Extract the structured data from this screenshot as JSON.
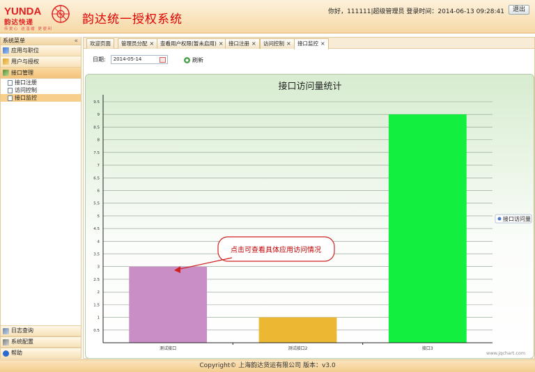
{
  "app": {
    "logo_text": "YUNDA",
    "logo_cn": "韵达快递",
    "logo_slogan": "传爱心 送温暖 更便利",
    "title": "韵达统一授权系统"
  },
  "header": {
    "user_info": "你好，111111|超级管理员  登录时间：2014-06-13 09:28:41",
    "logout_label": "退出"
  },
  "sidebar": {
    "title": "系统菜单",
    "collapse": "«",
    "groups": [
      {
        "label": "应用与职位"
      },
      {
        "label": "用户与授权"
      },
      {
        "label": "接口管理"
      }
    ],
    "sub_items": [
      {
        "label": "接口注册"
      },
      {
        "label": "访问控制"
      },
      {
        "label": "接口监控"
      }
    ],
    "bottom_groups": [
      {
        "label": "日志查询"
      },
      {
        "label": "系统配置"
      },
      {
        "label": "帮助"
      }
    ]
  },
  "tabs": [
    {
      "label": "欢迎页面",
      "close": ""
    },
    {
      "label": "管理员分配",
      "close": "×"
    },
    {
      "label": "查看用户权限(暂未启用)",
      "close": "×"
    },
    {
      "label": "接口注册",
      "close": "×"
    },
    {
      "label": "访问控制",
      "close": "×"
    },
    {
      "label": "接口监控",
      "close": "×"
    }
  ],
  "filter": {
    "date_label": "日期:",
    "date_value": "2014-05-14",
    "refresh_label": "刷新"
  },
  "callout": "点击可查看具体应用访问情况",
  "watermark": "www.jqchart.com",
  "footer": "Copyright© 上海韵达货运有限公司 版本：v3.0",
  "colors": {
    "accent": "#e00000",
    "header_bg": "#f6d9a6",
    "selected_item": "#f8cf8a"
  },
  "chart_data": {
    "type": "bar",
    "title": "接口访问量统计",
    "categories": [
      "测试接口",
      "测试接口2",
      "接口3"
    ],
    "series": [
      {
        "name": "接口访问量",
        "values": [
          3,
          1,
          9
        ],
        "colors": [
          "#c98ec6",
          "#ecb733",
          "#12ef3f"
        ]
      }
    ],
    "ylim": [
      0,
      9.5
    ],
    "yticks": [
      "0.5",
      "1",
      "1.5",
      "2",
      "2.5",
      "3",
      "3.5",
      "4",
      "4.5",
      "5",
      "5.5",
      "6",
      "6.5",
      "7",
      "7.5",
      "8",
      "8.5",
      "9",
      "9.5"
    ],
    "grid": true,
    "legend_position": "right"
  }
}
